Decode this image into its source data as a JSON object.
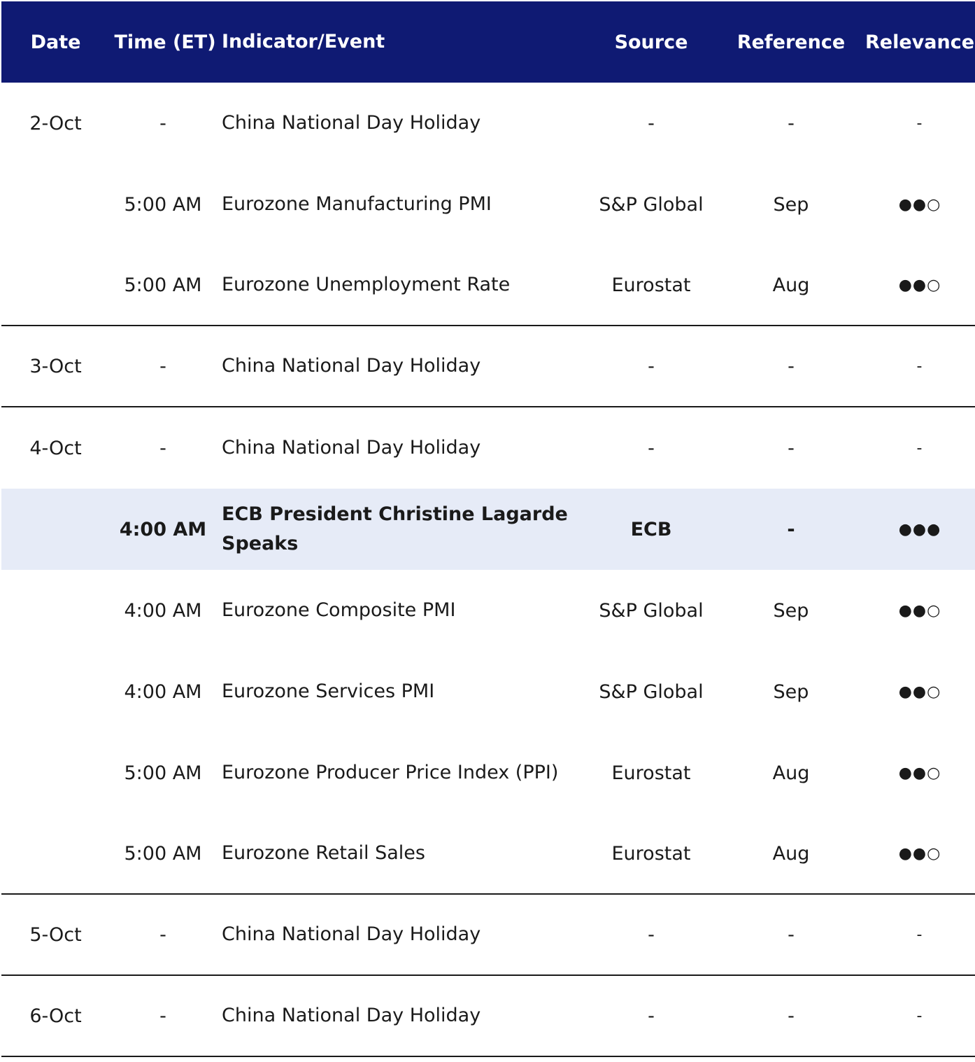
{
  "columns": {
    "date": "Date",
    "time": "Time (ET)",
    "event": "Indicator/Event",
    "source": "Source",
    "reference": "Reference",
    "relevance": "Relevance"
  },
  "rows": [
    {
      "date": "2-Oct",
      "time": "-",
      "event": "China National Day Holiday",
      "source": "-",
      "reference": "-",
      "relevance": "-"
    },
    {
      "date": "",
      "time": "5:00 AM",
      "event": "Eurozone Manufacturing PMI",
      "source": "S&P Global",
      "reference": "Sep",
      "relevance": "●●○"
    },
    {
      "date": "",
      "time": "5:00 AM",
      "event": "Eurozone Unemployment Rate",
      "source": "Eurostat",
      "reference": "Aug",
      "relevance": "●●○"
    },
    {
      "date": "3-Oct",
      "time": "-",
      "event": "China National Day Holiday",
      "source": "-",
      "reference": "-",
      "relevance": "-"
    },
    {
      "date": "4-Oct",
      "time": "-",
      "event": "China National Day Holiday",
      "source": "-",
      "reference": "-",
      "relevance": "-"
    },
    {
      "date": "",
      "time": "4:00 AM",
      "event": "ECB President Christine Lagarde Speaks",
      "source": "ECB",
      "reference": "-",
      "relevance": "●●●"
    },
    {
      "date": "",
      "time": "4:00 AM",
      "event": "Eurozone Composite PMI",
      "source": "S&P Global",
      "reference": "Sep",
      "relevance": "●●○"
    },
    {
      "date": "",
      "time": "4:00 AM",
      "event": "Eurozone Services PMI",
      "source": "S&P Global",
      "reference": "Sep",
      "relevance": "●●○"
    },
    {
      "date": "",
      "time": "5:00 AM",
      "event": "Eurozone Producer Price Index (PPI)",
      "source": "Eurostat",
      "reference": "Aug",
      "relevance": "●●○"
    },
    {
      "date": "",
      "time": "5:00 AM",
      "event": "Eurozone Retail Sales",
      "source": "Eurostat",
      "reference": "Aug",
      "relevance": "●●○"
    },
    {
      "date": "5-Oct",
      "time": "-",
      "event": "China National Day Holiday",
      "source": "-",
      "reference": "-",
      "relevance": "-"
    },
    {
      "date": "6-Oct",
      "time": "-",
      "event": "China National Day Holiday",
      "source": "-",
      "reference": "-",
      "relevance": "-"
    }
  ],
  "colors": {
    "header_bg": "#0f1a73",
    "highlight_bg": "#e6ebf7"
  }
}
